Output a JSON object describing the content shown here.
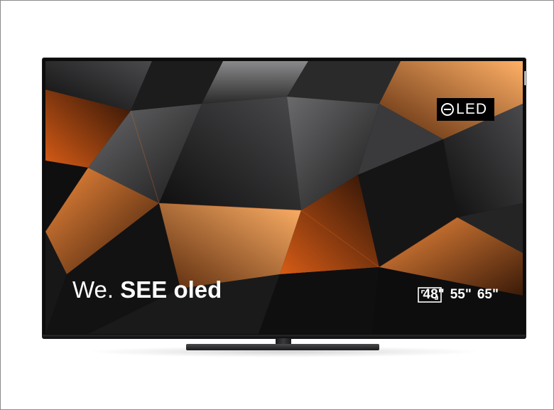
{
  "badge": {
    "label": "OLED",
    "text": "LED"
  },
  "tagline": {
    "prefix": "We.",
    "emphasis": "SEE oled"
  },
  "sizes": [
    "48\"",
    "55\"",
    "65\""
  ],
  "icons": {
    "badge_mark": "oled-o-icon",
    "screen": "screen-size-icon"
  },
  "colors": {
    "accent_orange": "#e06a22",
    "screen_dark": "#0b0b0c",
    "frame_gray": "#8a8a8a"
  }
}
